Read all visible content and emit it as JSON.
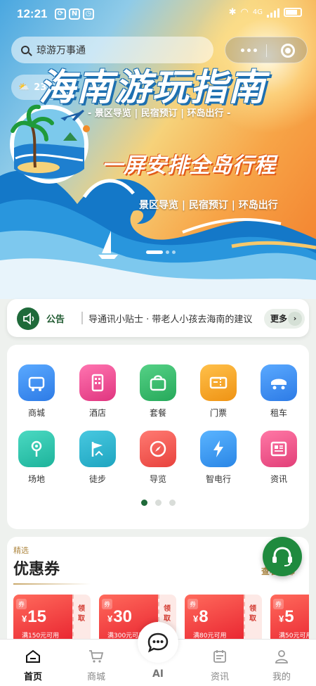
{
  "status_bar": {
    "time": "12:21",
    "network": "4G"
  },
  "search": {
    "placeholder": "琼游万事通"
  },
  "weather": {
    "temp": "23"
  },
  "banner": {
    "title": "海南游玩指南",
    "subtitle_top": "- 景区导览 | 民宿预订 | 环岛出行 -",
    "slogan": "一屏安排全岛行程",
    "subtitle_bottom": "景区导览 | 民宿预订 | 环岛出行",
    "carousel": {
      "count": 3,
      "active": 0
    }
  },
  "notice": {
    "label": "公告",
    "text": "导通讯小贴士 · 带老人小孩去海南的建议",
    "more": "更多",
    "more_arrow": "›"
  },
  "grid": {
    "items": [
      {
        "label": "商城",
        "icon": "shopping-cart-icon",
        "color": "#3d8ef0"
      },
      {
        "label": "酒店",
        "icon": "hotel-building-icon",
        "color": "#e6478c"
      },
      {
        "label": "套餐",
        "icon": "bag-icon",
        "color": "#36b567"
      },
      {
        "label": "门票",
        "icon": "ticket-icon",
        "color": "#f0a21e"
      },
      {
        "label": "租车",
        "icon": "car-icon",
        "color": "#3d8ef0"
      },
      {
        "label": "场地",
        "icon": "location-pin-icon",
        "color": "#27bfa7"
      },
      {
        "label": "徒步",
        "icon": "flag-icon",
        "color": "#27b3c9"
      },
      {
        "label": "导览",
        "icon": "compass-icon",
        "color": "#ee5a55"
      },
      {
        "label": "智电行",
        "icon": "lightning-icon",
        "color": "#3d9af0"
      },
      {
        "label": "资讯",
        "icon": "news-icon",
        "color": "#e8457a"
      }
    ],
    "pages": 3,
    "active_page": 0
  },
  "coupons": {
    "section_tag": "精选",
    "title": "优惠券",
    "view_all": "查看全部",
    "tag": "券",
    "currency": "¥",
    "claim": "领取",
    "items": [
      {
        "amount": "15",
        "condition": "满150元可用"
      },
      {
        "amount": "30",
        "condition": "满300元可用"
      },
      {
        "amount": "8",
        "condition": "满80元可用"
      },
      {
        "amount": "5",
        "condition": "满50元可用"
      }
    ]
  },
  "tabbar": {
    "items": [
      {
        "label": "首页",
        "icon": "home-icon"
      },
      {
        "label": "商城",
        "icon": "cart-icon"
      },
      {
        "label": "AI",
        "icon": "chat-bubble-icon"
      },
      {
        "label": "资讯",
        "icon": "calendar-news-icon"
      },
      {
        "label": "我的",
        "icon": "person-icon"
      }
    ],
    "active": "首页"
  },
  "colors": {
    "primary": "#1f6a3a",
    "fab": "#1f8a3e",
    "coupon": "#e8232f",
    "gold": "#b08a45"
  }
}
